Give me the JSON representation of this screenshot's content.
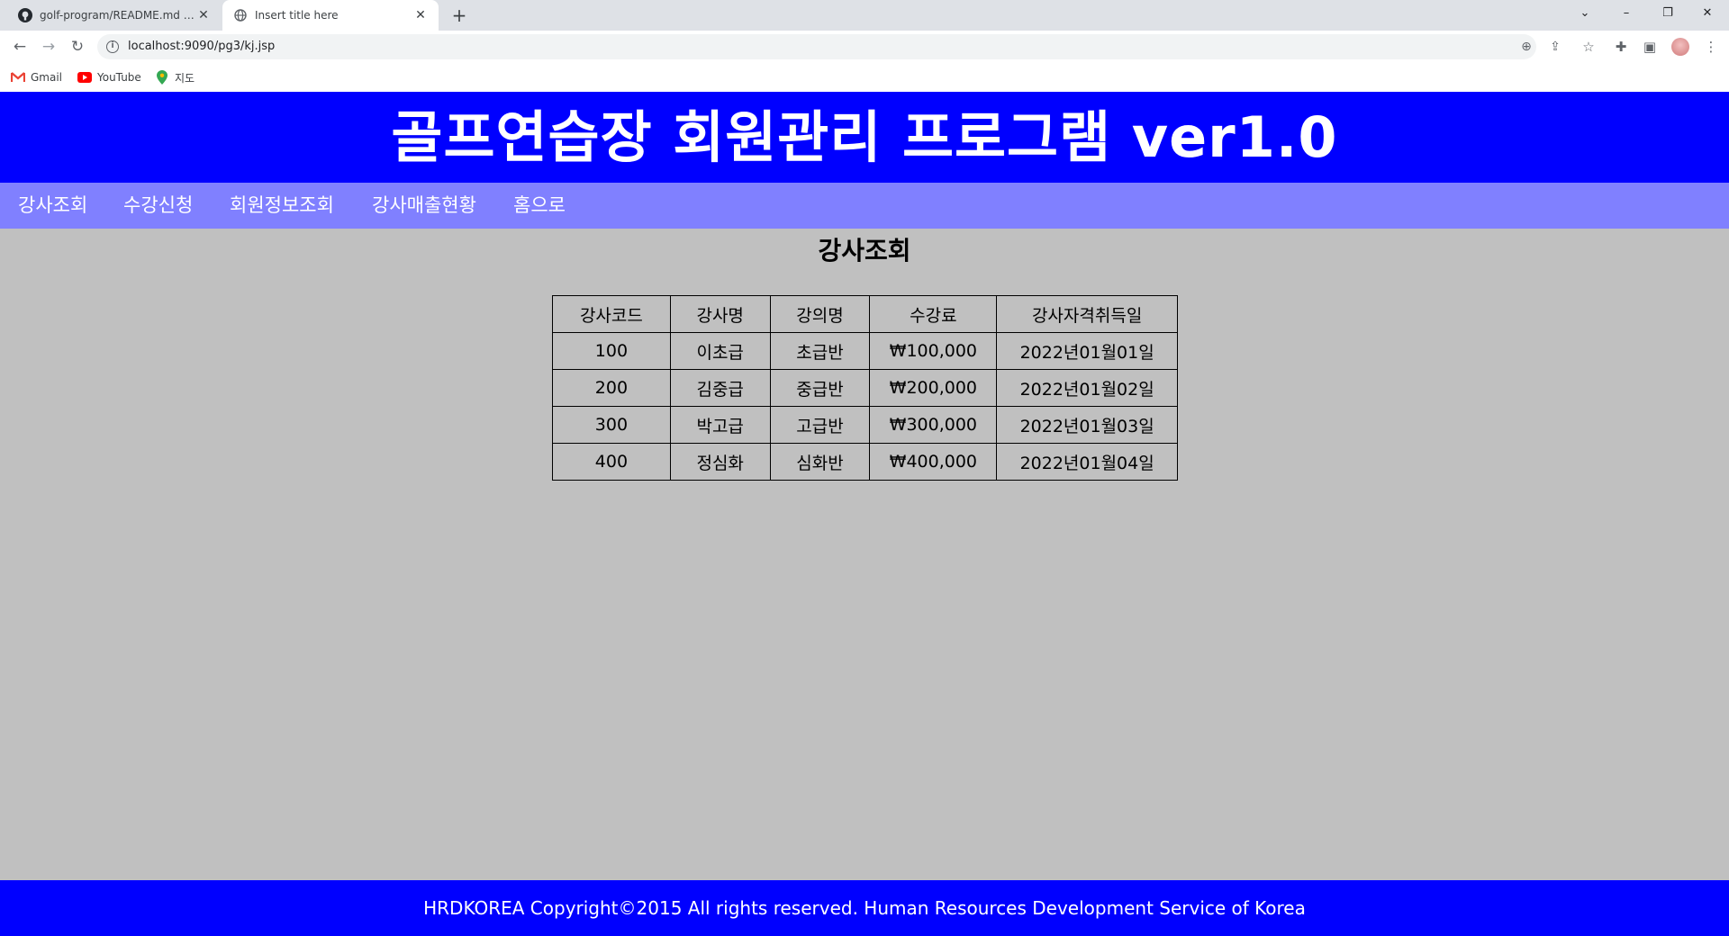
{
  "browser": {
    "tabs": [
      {
        "title": "golf-program/README.md at m",
        "active": false
      },
      {
        "title": "Insert title here",
        "active": true
      }
    ],
    "new_tab": "+",
    "url": "localhost:9090/pg3/kj.jsp",
    "bookmarks": [
      {
        "label": "Gmail"
      },
      {
        "label": "YouTube"
      },
      {
        "label": "지도"
      }
    ]
  },
  "site": {
    "title": "골프연습장 회원관리 프로그램 ver1.0",
    "nav": [
      "강사조회",
      "수강신청",
      "회원정보조회",
      "강사매출현황",
      "홈으로"
    ],
    "page_title": "강사조회",
    "table": {
      "headers": [
        "강사코드",
        "강사명",
        "강의명",
        "수강료",
        "강사자격취득일"
      ],
      "rows": [
        [
          "100",
          "이초급",
          "초급반",
          "₩100,000",
          "2022년01월01일"
        ],
        [
          "200",
          "김중급",
          "중급반",
          "₩200,000",
          "2022년01월02일"
        ],
        [
          "300",
          "박고급",
          "고급반",
          "₩300,000",
          "2022년01월03일"
        ],
        [
          "400",
          "정심화",
          "심화반",
          "₩400,000",
          "2022년01월04일"
        ]
      ]
    },
    "footer": "HRDKOREA Copyright©2015 All rights reserved. Human Resources Development Service of Korea"
  },
  "colors": {
    "header": "#0000ff",
    "nav": "#8080ff",
    "background": "#c0c0c0",
    "footer": "#0000ff"
  }
}
